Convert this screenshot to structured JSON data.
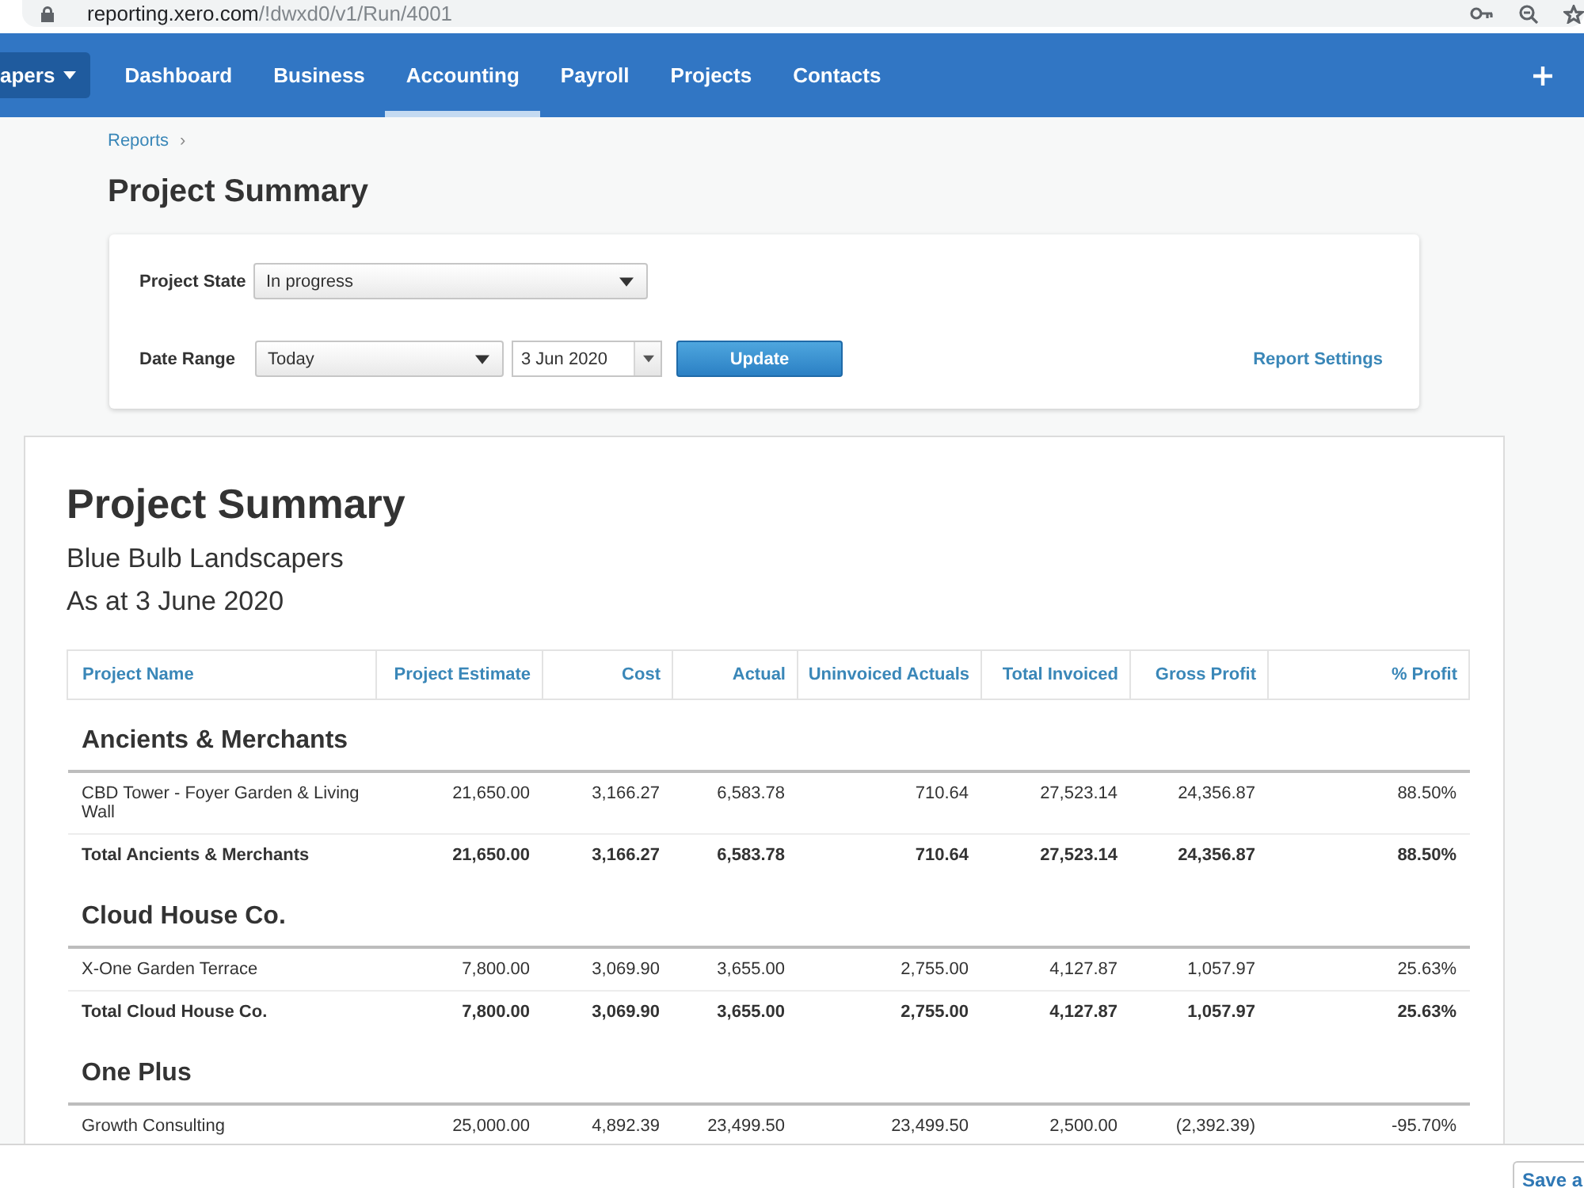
{
  "browser": {
    "url_host": "reporting.xero.com",
    "url_path": "/!dwxd0/v1/Run/4001"
  },
  "nav": {
    "org_button": "apers",
    "tabs": [
      {
        "label": "Dashboard",
        "selected": false
      },
      {
        "label": "Business",
        "selected": false
      },
      {
        "label": "Accounting",
        "selected": true
      },
      {
        "label": "Payroll",
        "selected": false
      },
      {
        "label": "Projects",
        "selected": false
      },
      {
        "label": "Contacts",
        "selected": false
      }
    ]
  },
  "breadcrumb": {
    "items": [
      "Reports"
    ],
    "separator": "›"
  },
  "page_title": "Project Summary",
  "filters": {
    "project_state": {
      "label": "Project State",
      "value": "In progress"
    },
    "date_range": {
      "label": "Date Range",
      "period": "Today",
      "date": "3 Jun 2020"
    },
    "update_button": "Update",
    "report_settings_link": "Report Settings"
  },
  "report": {
    "title": "Project Summary",
    "organisation": "Blue Bulb Landscapers",
    "as_at": "As at 3 June 2020",
    "table": {
      "columns": [
        "Project Name",
        "Project Estimate",
        "Cost",
        "Actual",
        "Uninvoiced Actuals",
        "Total Invoiced",
        "Gross Profit",
        "% Profit"
      ],
      "groups": [
        {
          "name": "Ancients & Merchants",
          "rows": [
            [
              "CBD Tower - Foyer Garden & Living Wall",
              "21,650.00",
              "3,166.27",
              "6,583.78",
              "710.64",
              "27,523.14",
              "24,356.87",
              "88.50%"
            ]
          ],
          "total": [
            "Total Ancients & Merchants",
            "21,650.00",
            "3,166.27",
            "6,583.78",
            "710.64",
            "27,523.14",
            "24,356.87",
            "88.50%"
          ]
        },
        {
          "name": "Cloud House Co.",
          "rows": [
            [
              "X-One Garden Terrace",
              "7,800.00",
              "3,069.90",
              "3,655.00",
              "2,755.00",
              "4,127.87",
              "1,057.97",
              "25.63%"
            ]
          ],
          "total": [
            "Total Cloud House Co.",
            "7,800.00",
            "3,069.90",
            "3,655.00",
            "2,755.00",
            "4,127.87",
            "1,057.97",
            "25.63%"
          ]
        },
        {
          "name": "One Plus",
          "rows": [
            [
              "Growth Consulting",
              "25,000.00",
              "4,892.39",
              "23,499.50",
              "23,499.50",
              "2,500.00",
              "(2,392.39)",
              "-95.70%"
            ]
          ]
        }
      ]
    }
  },
  "footer": {
    "save_button": "Save a"
  }
}
